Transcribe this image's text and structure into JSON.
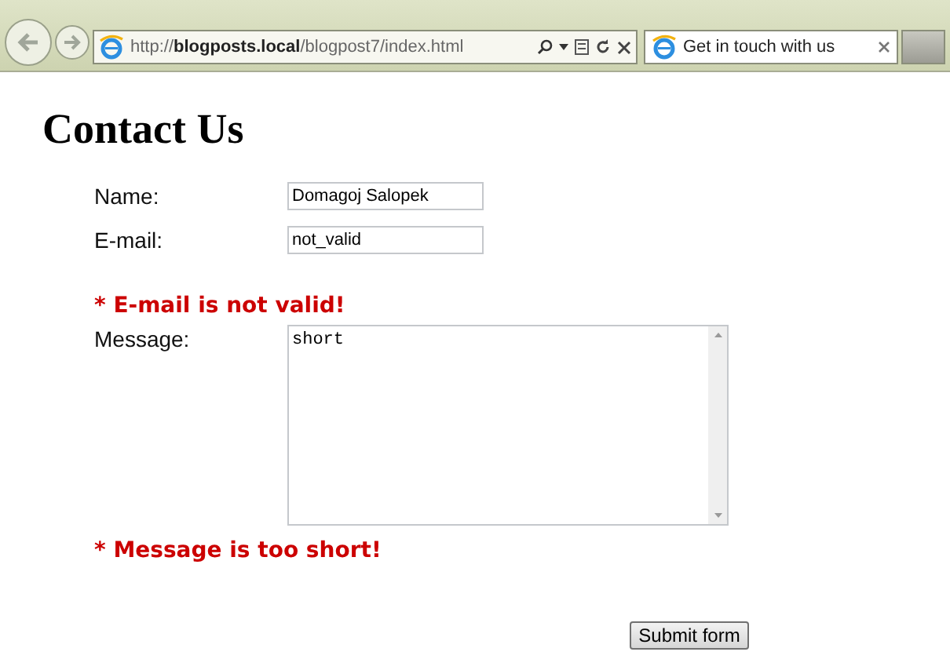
{
  "browser": {
    "address": "http://**blogposts.local**/blogpost7/index.html",
    "tab": {
      "title": "Get in touch with us",
      "selected": true
    }
  },
  "page": {
    "heading": "Contact Us",
    "fields": [
      {
        "kind": "input",
        "label": "Name:",
        "value": "Domagoj Salopek"
      },
      {
        "kind": "input",
        "label": "E-mail:",
        "value": "not_valid",
        "error": "* E-mail is not valid!"
      },
      {
        "kind": "textarea",
        "label": "Message:",
        "value": "short",
        "error": "* Message is too short!"
      }
    ],
    "submit": "Submit form"
  }
}
